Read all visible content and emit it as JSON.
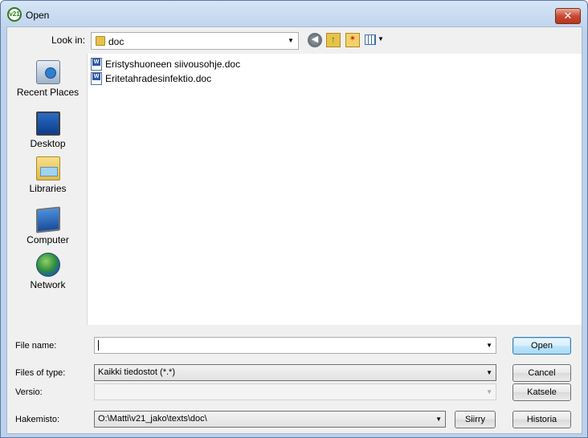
{
  "window": {
    "title": "Open",
    "app_icon_text": "v21",
    "close_label": "✕"
  },
  "toolbar": {
    "lookin_label": "Look in:",
    "lookin_value": "doc",
    "icons": [
      "back-icon",
      "up-folder-icon",
      "new-folder-icon",
      "view-menu-icon"
    ]
  },
  "places": [
    {
      "label": "Recent Places",
      "icon": "recent-places-icon"
    },
    {
      "label": "Desktop",
      "icon": "desktop-icon"
    },
    {
      "label": "Libraries",
      "icon": "libraries-icon"
    },
    {
      "label": "Computer",
      "icon": "computer-icon"
    },
    {
      "label": "Network",
      "icon": "network-icon"
    }
  ],
  "files": [
    {
      "name": "Eristyshuoneen siivousohje.doc",
      "icon": "word-doc-icon"
    },
    {
      "name": "Eritetahradesinfektio.doc",
      "icon": "word-doc-icon"
    }
  ],
  "form": {
    "filename_label": "File name:",
    "filename_value": "",
    "filetype_label": "Files of type:",
    "filetype_value": "Kaikki tiedostot (*.*)",
    "versio_label": "Versio:",
    "versio_value": "",
    "hakemisto_label": "Hakemisto:",
    "hakemisto_value": "O:\\Matti\\v21_jako\\texts\\doc\\"
  },
  "buttons": {
    "open": "Open",
    "cancel": "Cancel",
    "katsele": "Katsele",
    "siirry": "Siirry",
    "historia": "Historia"
  }
}
